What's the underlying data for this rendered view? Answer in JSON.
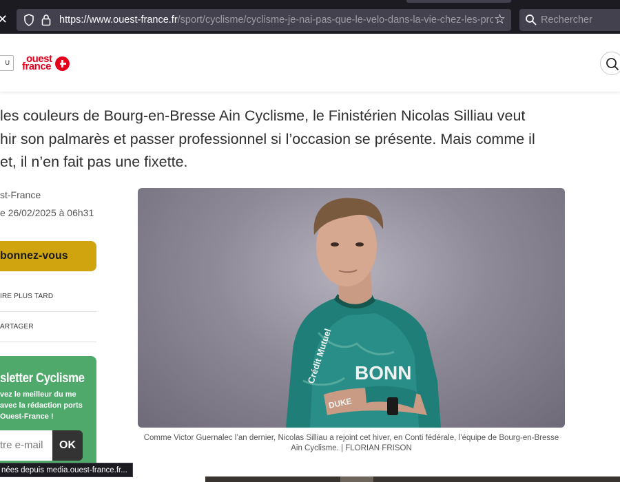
{
  "browser": {
    "url_host": "https://www.ouest-france.fr",
    "url_path": "/sport/cyclisme/cyclisme-je-nai-pas-que-le-velo-dans-la-vie-chez-les-pros-",
    "search_placeholder": "Rechercher",
    "status_text": "nées depuis media.ouest-france.fr..."
  },
  "site": {
    "menu_label": "U",
    "logo_text_line1": "ouest",
    "logo_text_line2": "france",
    "brand_color": "#e2001a"
  },
  "article": {
    "lede_lines": [
      "les couleurs de Bourg-en-Bresse Ain Cyclisme, le Finistérien Nicolas Silliau veut",
      "hir son palmarès et passer professionnel si l’occasion se présente. Mais comme il",
      "et, il n’en fait pas une fixette."
    ],
    "author": "st-France",
    "date": "e 26/02/2025 à 06h31",
    "caption": "Comme Victor Guernalec l’an dernier, Nicolas Silliau a rejoint cet hiver, en Conti fédérale, l’équipe de Bourg-en-Bresse Ain Cyclisme. | FLORIAN FRISON"
  },
  "sidebar": {
    "subscribe_label": "bonnez-vous",
    "read_later_label": "IRE PLUS TARD",
    "share_label": "ARTAGER",
    "newsletter_title": "sletter Cyclisme",
    "newsletter_desc": "vez le meilleur du me avec la rédaction ports Ouest-France !",
    "email_placeholder": "tre e-mail",
    "ok_label": "OK"
  },
  "photo_jersey_text": {
    "sponsor": "BONN",
    "sleeve": "Crédit Mutuel",
    "hem": "DUKE"
  }
}
